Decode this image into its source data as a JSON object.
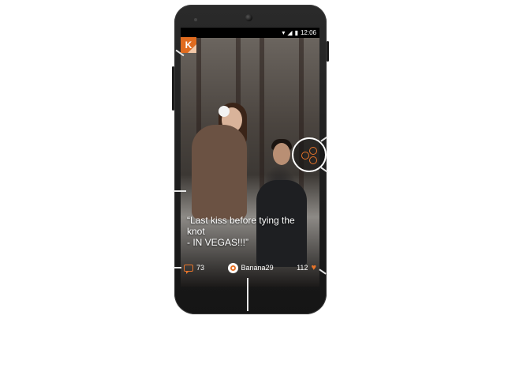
{
  "status_bar": {
    "time": "12:06",
    "signal_icon": "signal-icon",
    "wifi_icon": "wifi-icon",
    "battery_icon": "battery-icon"
  },
  "app": {
    "logo_letter": "K",
    "logo_icon": "app-logo-icon",
    "accent_color": "#e06b1f"
  },
  "post": {
    "caption": "“Last kiss before tying the  knot\n- IN VEGAS!!!”",
    "comment_count": "73",
    "username": "Banana29",
    "like_count": "112"
  }
}
